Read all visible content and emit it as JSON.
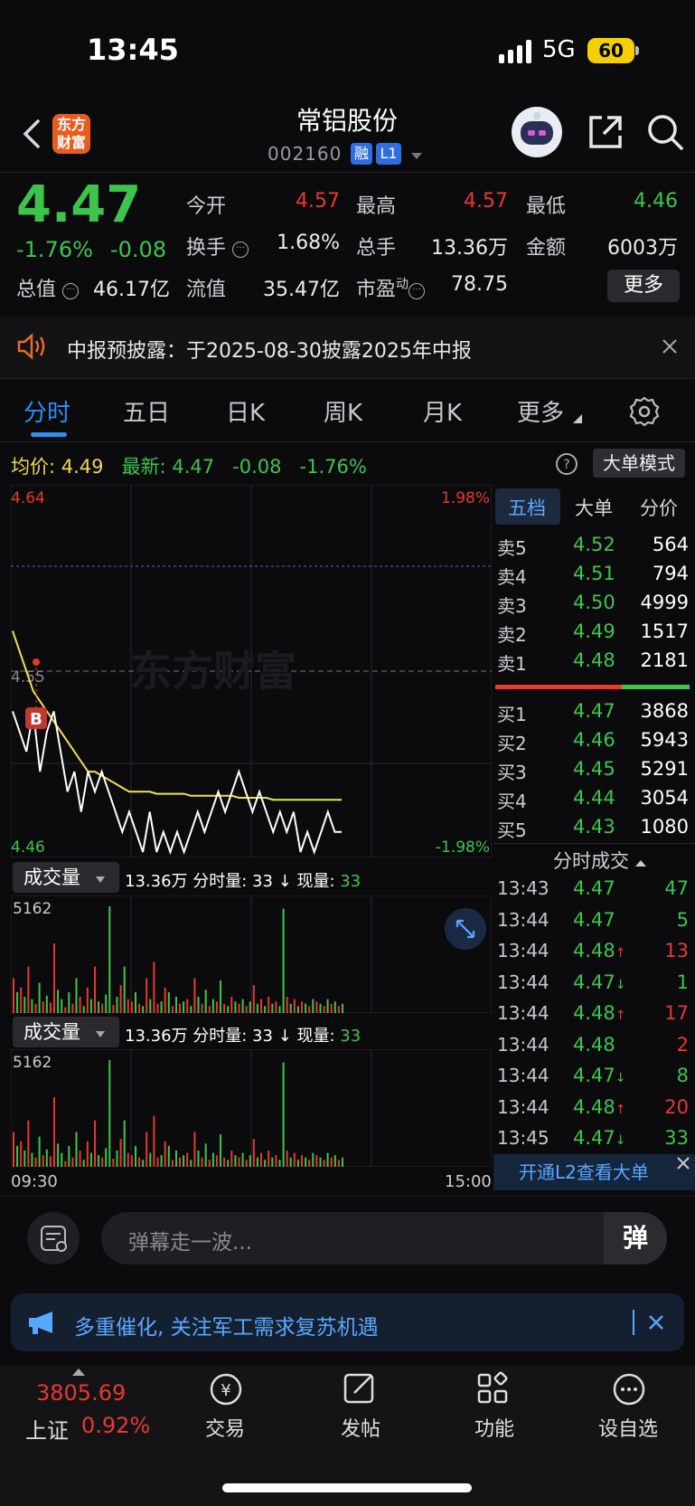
{
  "status": {
    "time": "13:45",
    "network": "5G",
    "battery": "60"
  },
  "header": {
    "logo_text": "东方财富",
    "name": "常铝股份",
    "code": "002160",
    "tags": [
      "融",
      "L1"
    ]
  },
  "quote": {
    "price": "4.47",
    "change_pct": "-1.76%",
    "change_abs": "-0.08",
    "fields": [
      {
        "label": "今开",
        "value": "4.57",
        "color": "#e8382f"
      },
      {
        "label": "最高",
        "value": "4.57",
        "color": "#e8382f"
      },
      {
        "label": "最低",
        "value": "4.46",
        "color": "#3ec44c"
      },
      {
        "label": "换手",
        "value": "1.68%",
        "color": "#ececec"
      },
      {
        "label": "总手",
        "value": "13.36万",
        "color": "#ececec"
      },
      {
        "label": "金额",
        "value": "6003万",
        "color": "#ececec"
      },
      {
        "label": "总值",
        "value": "46.17亿",
        "color": "#ececec"
      },
      {
        "label": "流值",
        "value": "35.47亿",
        "color": "#ececec"
      },
      {
        "label": "市盈",
        "value": "78.75",
        "color": "#ececec"
      }
    ],
    "pe_superscript": "动",
    "more_label": "更多"
  },
  "notice": {
    "text": "中报预披露：于2025-08-30披露2025年中报"
  },
  "tabs": [
    "分时",
    "五日",
    "日K",
    "周K",
    "月K",
    "更多"
  ],
  "avg_bar": {
    "avg_label": "均价:",
    "avg_value": "4.49",
    "latest_label": "最新:",
    "latest_value": "4.47",
    "change": "-0.08",
    "pct": "-1.76%",
    "mode_button": "大单模式"
  },
  "chart_data": [
    {
      "type": "line",
      "ylim": [
        4.46,
        4.64
      ],
      "tick_labels": {
        "top_left": "4.64",
        "bottom_left": "4.46",
        "top_right": "1.98%",
        "bottom_right": "-1.98%",
        "mid": "4.55"
      },
      "x_labels": [
        "09:30",
        "15:00"
      ],
      "watermark": "东方财富",
      "marker": "B",
      "series": [
        {
          "name": "price",
          "color": "#ffffff",
          "values": [
            4.53,
            4.52,
            4.51,
            4.53,
            4.5,
            4.52,
            4.53,
            4.51,
            4.49,
            4.5,
            4.48,
            4.5,
            4.49,
            4.5,
            4.49,
            4.48,
            4.47,
            4.48,
            4.47,
            4.46,
            4.48,
            4.46,
            4.47,
            4.46,
            4.47,
            4.46,
            4.47,
            4.48,
            4.47,
            4.48,
            4.49,
            4.48,
            4.49,
            4.5,
            4.49,
            4.48,
            4.49,
            4.48,
            4.47,
            4.48,
            4.47,
            4.48,
            4.46,
            4.47,
            4.46,
            4.47,
            4.48,
            4.47,
            4.47
          ]
        },
        {
          "name": "avg",
          "color": "#f1e05a",
          "values": [
            4.57,
            4.56,
            4.55,
            4.54,
            4.535,
            4.53,
            4.525,
            4.52,
            4.515,
            4.51,
            4.505,
            4.5,
            4.5,
            4.498,
            4.496,
            4.494,
            4.492,
            4.49,
            4.49,
            4.49,
            4.49,
            4.489,
            4.489,
            4.489,
            4.489,
            4.489,
            4.488,
            4.488,
            4.488,
            4.488,
            4.488,
            4.488,
            4.488,
            4.487,
            4.487,
            4.487,
            4.487,
            4.487,
            4.486,
            4.486,
            4.486,
            4.486,
            4.486,
            4.486,
            4.486,
            4.486,
            4.486,
            4.486,
            4.486
          ]
        }
      ]
    },
    {
      "type": "bar",
      "label": "成交量",
      "total": "13.36万",
      "detail": "分时量: 33 ↓ 现量:",
      "current": "33",
      "ymax_label": "5162",
      "values": [
        30,
        18,
        22,
        14,
        40,
        12,
        8,
        26,
        10,
        15,
        9,
        60,
        20,
        12,
        5,
        18,
        8,
        30,
        14,
        6,
        22,
        12,
        40,
        10,
        8,
        16,
        92,
        7,
        14,
        24,
        40,
        12,
        10,
        18,
        8,
        6,
        30,
        12,
        44,
        8,
        10,
        22,
        18,
        6,
        14,
        8,
        10,
        12,
        6,
        30,
        14,
        8,
        20,
        6,
        12,
        10,
        28,
        8,
        6,
        14,
        10,
        8,
        12,
        6,
        10,
        24,
        8,
        12,
        6,
        14,
        8,
        10,
        6,
        90,
        14,
        8,
        12,
        6,
        10,
        8,
        6,
        12,
        10,
        8,
        6,
        12,
        8,
        10,
        6,
        8
      ],
      "colors": [
        "r",
        "g",
        "r",
        "g",
        "r",
        "g",
        "r",
        "g",
        "r",
        "g",
        "r",
        "r",
        "g",
        "g",
        "r",
        "g",
        "r",
        "g",
        "r",
        "g",
        "r",
        "g",
        "r",
        "g",
        "r",
        "g",
        "g",
        "r",
        "g",
        "r",
        "g",
        "r",
        "r",
        "g",
        "r",
        "g",
        "r",
        "g",
        "r",
        "r",
        "g",
        "r",
        "g",
        "r",
        "g",
        "r",
        "g",
        "r",
        "g",
        "r",
        "g",
        "r",
        "g",
        "r",
        "g",
        "r",
        "g",
        "r",
        "g",
        "r",
        "g",
        "r",
        "g",
        "r",
        "g",
        "r",
        "g",
        "r",
        "g",
        "r",
        "g",
        "r",
        "g",
        "g",
        "r",
        "g",
        "r",
        "g",
        "r",
        "g",
        "r",
        "g",
        "r",
        "g",
        "r",
        "g",
        "r",
        "g",
        "r",
        "g"
      ]
    }
  ],
  "vol2": {
    "label": "成交量",
    "total": "13.36万",
    "detail": "分时量: 33 ↓ 现量:",
    "current": "33",
    "ymax_label": "5162"
  },
  "orderbook": {
    "tabs": [
      "五档",
      "大单",
      "分价"
    ],
    "asks": [
      {
        "label": "卖5",
        "price": "4.52",
        "vol": "564"
      },
      {
        "label": "卖4",
        "price": "4.51",
        "vol": "794"
      },
      {
        "label": "卖3",
        "price": "4.50",
        "vol": "4999"
      },
      {
        "label": "卖2",
        "price": "4.49",
        "vol": "1517"
      },
      {
        "label": "卖1",
        "price": "4.48",
        "vol": "2181"
      }
    ],
    "bids": [
      {
        "label": "买1",
        "price": "4.47",
        "vol": "3868"
      },
      {
        "label": "买2",
        "price": "4.46",
        "vol": "5943"
      },
      {
        "label": "买3",
        "price": "4.45",
        "vol": "5291"
      },
      {
        "label": "买4",
        "price": "4.44",
        "vol": "3054"
      },
      {
        "label": "买5",
        "price": "4.43",
        "vol": "1080"
      }
    ]
  },
  "ticks": {
    "title": "分时成交",
    "rows": [
      {
        "time": "13:43",
        "price": "4.47",
        "arrow": "",
        "vol": "47",
        "vcolor": "#3ec44c"
      },
      {
        "time": "13:44",
        "price": "4.47",
        "arrow": "",
        "vol": "5",
        "vcolor": "#3ec44c"
      },
      {
        "time": "13:44",
        "price": "4.48",
        "arrow": "↑",
        "vol": "13",
        "vcolor": "#e8382f"
      },
      {
        "time": "13:44",
        "price": "4.47",
        "arrow": "↓",
        "vol": "1",
        "vcolor": "#3ec44c"
      },
      {
        "time": "13:44",
        "price": "4.48",
        "arrow": "↑",
        "vol": "17",
        "vcolor": "#e8382f"
      },
      {
        "time": "13:44",
        "price": "4.48",
        "arrow": "",
        "vol": "2",
        "vcolor": "#e8382f"
      },
      {
        "time": "13:44",
        "price": "4.47",
        "arrow": "↓",
        "vol": "8",
        "vcolor": "#3ec44c"
      },
      {
        "time": "13:44",
        "price": "4.48",
        "arrow": "↑",
        "vol": "20",
        "vcolor": "#e8382f"
      },
      {
        "time": "13:45",
        "price": "4.47",
        "arrow": "↓",
        "vol": "33",
        "vcolor": "#3ec44c"
      }
    ],
    "l2_button": "开通L2查看大单"
  },
  "danmu": {
    "placeholder": "弹幕走一波...",
    "button": "弹"
  },
  "promo": {
    "text": "多重催化, 关注军工需求复苏机遇"
  },
  "bottom_nav": {
    "index_value": "3805.69",
    "index_name": "上证",
    "index_pct": "0.92%",
    "items": [
      {
        "label": "交易"
      },
      {
        "label": "发帖"
      },
      {
        "label": "功能"
      },
      {
        "label": "设自选"
      }
    ]
  }
}
